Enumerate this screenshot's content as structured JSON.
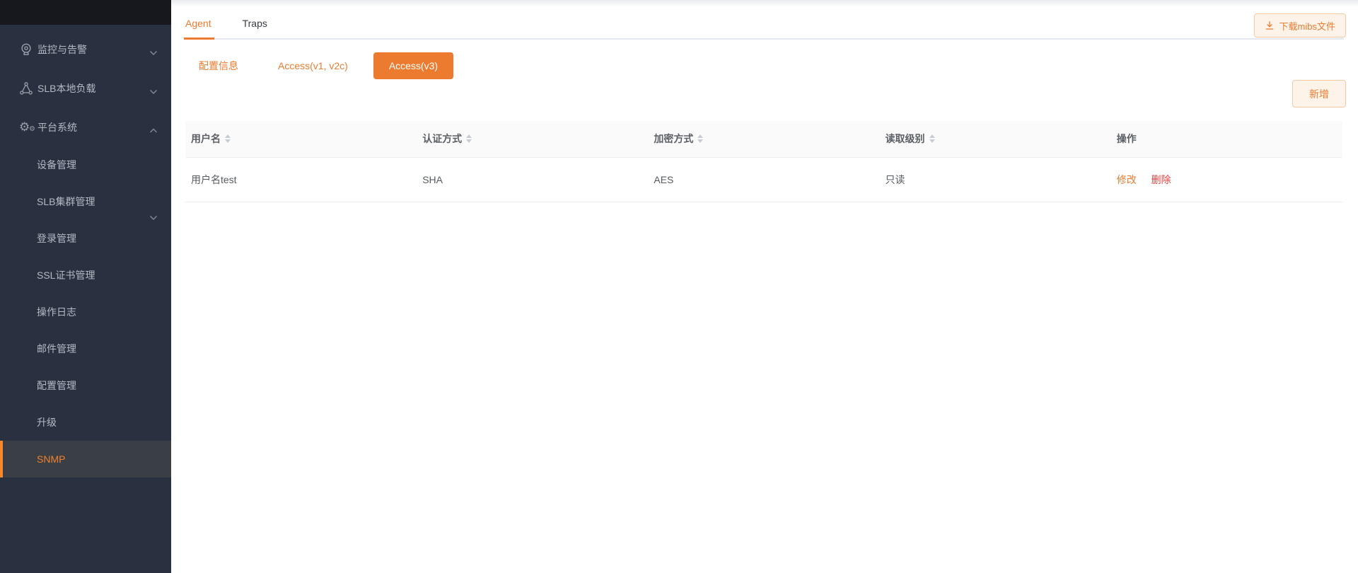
{
  "colors": {
    "accent_orange": "#ED7B2F",
    "danger_red": "#f23c3c",
    "sidebar_bg": "#293140",
    "sidebar_active_bg": "#3a3f46",
    "sidebar_active_bar": "#f6892f",
    "light_button_bg": "#fdf3e9",
    "light_button_border": "#f6c9a2",
    "table_header_bg": "#fafafa"
  },
  "sidebar": {
    "sections": [
      {
        "label": "监控与告警",
        "icon": "webcam-icon",
        "chevron": "down"
      },
      {
        "label": "SLB本地负载",
        "icon": "share-network-icon",
        "chevron": "down"
      },
      {
        "label": "平台系统",
        "icon": "gears-icon",
        "chevron": "up",
        "expanded": true
      }
    ],
    "platform_children": [
      {
        "label": "设备管理"
      },
      {
        "label": "SLB集群管理",
        "chevron": "down"
      },
      {
        "label": "登录管理"
      },
      {
        "label": "SSL证书管理"
      },
      {
        "label": "操作日志"
      },
      {
        "label": "邮件管理"
      },
      {
        "label": "配置管理"
      },
      {
        "label": "升级"
      },
      {
        "label": "SNMP",
        "active": true
      }
    ]
  },
  "main": {
    "tabs": [
      {
        "label": "Agent",
        "active": true
      },
      {
        "label": "Traps",
        "active": false
      }
    ],
    "download_button_label": "下载mibs文件",
    "download_icon": "download-icon",
    "subtabs": [
      {
        "label": "配置信息",
        "active": false
      },
      {
        "label": "Access(v1, v2c)",
        "active": false
      },
      {
        "label": "Access(v3)",
        "active": true
      }
    ],
    "add_button_label": "新增",
    "table": {
      "columns": [
        {
          "label": "用户名",
          "sortable": true
        },
        {
          "label": "认证方式",
          "sortable": true
        },
        {
          "label": "加密方式",
          "sortable": true
        },
        {
          "label": "读取级别",
          "sortable": true
        },
        {
          "label": "操作",
          "sortable": false
        }
      ],
      "rows": [
        {
          "username": "用户名test",
          "auth_method": "SHA",
          "encryption": "AES",
          "access_level": "只读",
          "actions": [
            "修改",
            "删除"
          ]
        }
      ]
    }
  }
}
